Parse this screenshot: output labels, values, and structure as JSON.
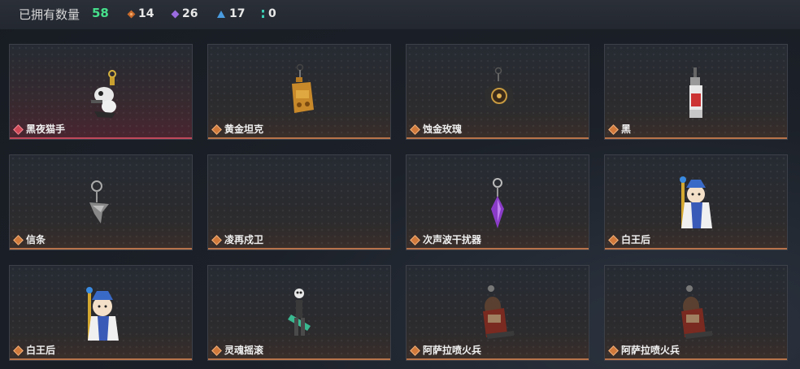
{
  "header": {
    "title": "已拥有数量",
    "total": "58",
    "stats": [
      {
        "icon": "orange-gem-icon",
        "value": "14"
      },
      {
        "icon": "purple-gem-icon",
        "value": "26"
      },
      {
        "icon": "blue-gem-icon",
        "value": "17"
      },
      {
        "icon": "teal-gem-icon",
        "value": "0"
      }
    ]
  },
  "items": [
    {
      "name": "黑夜猫手",
      "icon": "cat-paw-charm-icon",
      "rarity": "rare"
    },
    {
      "name": "黄金坦克",
      "icon": "golden-tank-charm-icon",
      "rarity": "normal"
    },
    {
      "name": "蚀金玫瑰",
      "icon": "gilded-rose-charm-icon",
      "rarity": "normal"
    },
    {
      "name": "黑",
      "icon": "black-tag-charm-icon",
      "rarity": "normal"
    },
    {
      "name": "信条",
      "icon": "creed-charm-icon",
      "rarity": "normal"
    },
    {
      "name": "凌再戍卫",
      "icon": "guard-charm-icon",
      "rarity": "normal"
    },
    {
      "name": "次声波干扰器",
      "icon": "purple-crystal-charm-icon",
      "rarity": "normal"
    },
    {
      "name": "白王后",
      "icon": "white-queen-charm-icon",
      "rarity": "normal"
    },
    {
      "name": "白王后",
      "icon": "white-queen-charm-icon",
      "rarity": "normal"
    },
    {
      "name": "灵魂摇滚",
      "icon": "skeleton-rocker-charm-icon",
      "rarity": "normal"
    },
    {
      "name": "阿萨拉喷火兵",
      "icon": "flamethrower-soldier-charm-icon",
      "rarity": "normal"
    },
    {
      "name": "阿萨拉喷火兵",
      "icon": "flamethrower-soldier-charm-icon",
      "rarity": "normal"
    }
  ]
}
